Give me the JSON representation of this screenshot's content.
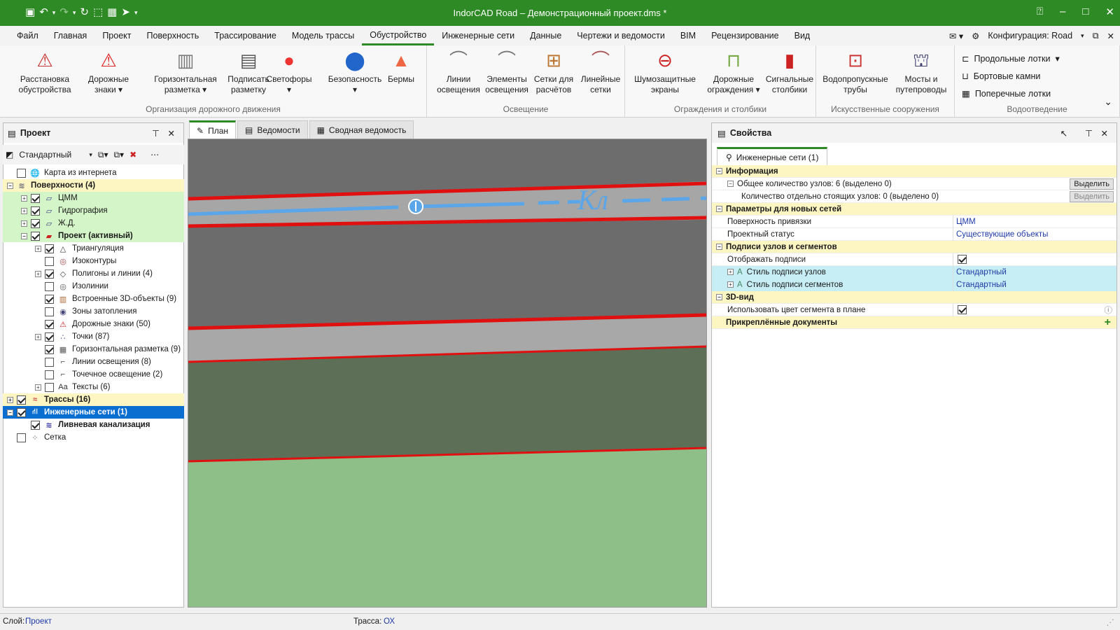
{
  "window": {
    "title": "IndorCAD Road – Демонстрационный проект.dms *"
  },
  "menu": [
    "Файл",
    "Главная",
    "Проект",
    "Поверхность",
    "Трассирование",
    "Модель трассы",
    "Обустройство",
    "Инженерные сети",
    "Данные",
    "Чертежи и ведомости",
    "BIM",
    "Рецензирование",
    "Вид"
  ],
  "menu_active": "Обустройство",
  "config_label": "Конфигурация: Road",
  "ribbon": {
    "groups": [
      {
        "label": "Организация дорожного движения",
        "buttons": [
          "Расстановка\nобустройства",
          "Дорожные\nзнаки ▾",
          "Горизонтальная\nразметка ▾",
          "Подписать\nразметку",
          "Светофоры\n▾",
          "Безопасность\n▾",
          "Бермы"
        ]
      },
      {
        "label": "Освещение",
        "buttons": [
          "Линии\nосвещения",
          "Элементы\nосвещения",
          "Сетки для\nрасчётов",
          "Линейные\nсетки"
        ]
      },
      {
        "label": "Ограждения и столбики",
        "buttons": [
          "Шумозащитные\nэкраны",
          "Дорожные\nограждения ▾",
          "Сигнальные\nстолбики"
        ]
      },
      {
        "label": "Искусственные сооружения",
        "buttons": [
          "Водопропускные\nтрубы",
          "Мосты и\nпутепроводы"
        ]
      },
      {
        "label": "Водоотведение",
        "small": [
          "Продольные лотки",
          "Бортовые камни",
          "Поперечные лотки"
        ]
      }
    ]
  },
  "left_panel": {
    "title": "Проект",
    "view_mode": "Стандартный",
    "tree": [
      {
        "label": "Карта из интернета",
        "level": 0,
        "exp": "",
        "cb": false,
        "style": ""
      },
      {
        "label": "Поверхности (4)",
        "level": 0,
        "exp": "−",
        "cb": null,
        "style": "sec"
      },
      {
        "label": "ЦММ",
        "level": 1,
        "exp": "+",
        "cb": true,
        "style": "hl"
      },
      {
        "label": "Гидрография",
        "level": 1,
        "exp": "+",
        "cb": true,
        "style": "hl"
      },
      {
        "label": "Ж.Д.",
        "level": 1,
        "exp": "+",
        "cb": true,
        "style": "hl"
      },
      {
        "label": "Проект (активный)",
        "level": 1,
        "exp": "−",
        "cb": true,
        "style": "hl bold"
      },
      {
        "label": "Триангуляция",
        "level": 2,
        "exp": "+",
        "cb": true,
        "style": ""
      },
      {
        "label": "Изоконтуры",
        "level": 2,
        "exp": "",
        "cb": false,
        "style": ""
      },
      {
        "label": "Полигоны и линии (4)",
        "level": 2,
        "exp": "+",
        "cb": true,
        "style": ""
      },
      {
        "label": "Изолинии",
        "level": 2,
        "exp": "",
        "cb": false,
        "style": ""
      },
      {
        "label": "Встроенные 3D-объекты (9)",
        "level": 2,
        "exp": "",
        "cb": true,
        "style": ""
      },
      {
        "label": "Зоны затопления",
        "level": 2,
        "exp": "",
        "cb": false,
        "style": ""
      },
      {
        "label": "Дорожные знаки (50)",
        "level": 2,
        "exp": "",
        "cb": true,
        "style": ""
      },
      {
        "label": "Точки (87)",
        "level": 2,
        "exp": "+",
        "cb": true,
        "style": ""
      },
      {
        "label": "Горизонтальная разметка (9)",
        "level": 2,
        "exp": "",
        "cb": true,
        "style": ""
      },
      {
        "label": "Линии освещения (8)",
        "level": 2,
        "exp": "",
        "cb": false,
        "style": ""
      },
      {
        "label": "Точечное освещение (2)",
        "level": 2,
        "exp": "",
        "cb": false,
        "style": ""
      },
      {
        "label": "Тексты (6)",
        "level": 2,
        "exp": "+",
        "cb": false,
        "style": ""
      },
      {
        "label": "Трассы (16)",
        "level": 0,
        "exp": "+",
        "cb": true,
        "style": "sec"
      },
      {
        "label": "Инженерные сети (1)",
        "level": 0,
        "exp": "−",
        "cb": true,
        "style": "sel"
      },
      {
        "label": "Ливневая канализация",
        "level": 1,
        "exp": "",
        "cb": true,
        "style": "bold"
      },
      {
        "label": "Сетка",
        "level": 0,
        "exp": "",
        "cb": false,
        "style": ""
      }
    ]
  },
  "doc_tabs": [
    "План",
    "Ведомости",
    "Сводная ведомость"
  ],
  "canvas": {
    "label_text": "Кл"
  },
  "right_panel": {
    "title": "Свойства",
    "tab": "Инженерные сети (1)",
    "rows": [
      {
        "kind": "sec",
        "name": "Информация"
      },
      {
        "kind": "row",
        "name": "Общее количество узлов: 6 (выделено 0)",
        "btn": "Выделить",
        "indent": 1
      },
      {
        "kind": "row",
        "name": "Количество отдельно стоящих узлов: 0 (выделено 0)",
        "btn": "Выделить",
        "btn_dis": true,
        "indent": 2
      },
      {
        "kind": "sec",
        "name": "Параметры для новых сетей"
      },
      {
        "kind": "row",
        "name": "Поверхность привязки",
        "value": "ЦММ",
        "indent": 1
      },
      {
        "kind": "row",
        "name": "Проектный статус",
        "value": "Существующие объекты",
        "indent": 1
      },
      {
        "kind": "sec",
        "name": "Подписи узлов и сегментов"
      },
      {
        "kind": "row",
        "name": "Отображать подписи",
        "check": true,
        "indent": 1
      },
      {
        "kind": "row",
        "name": "Стиль подписи узлов",
        "value": "Стандартный",
        "cyan": true,
        "indent": 1,
        "exp": true
      },
      {
        "kind": "row",
        "name": "Стиль подписи сегментов",
        "value": "Стандартный",
        "cyan": true,
        "indent": 1,
        "exp": true
      },
      {
        "kind": "sec",
        "name": "3D-вид"
      },
      {
        "kind": "row",
        "name": "Использовать цвет сегмента в плане",
        "check": true,
        "indent": 1,
        "info": true
      },
      {
        "kind": "sec",
        "name": "Прикреплённые документы",
        "plus": true
      }
    ]
  },
  "status": {
    "layer_label": "Слой:",
    "layer_value": "Проект",
    "route_label": "Трасса:",
    "route_value": "ОХ"
  }
}
